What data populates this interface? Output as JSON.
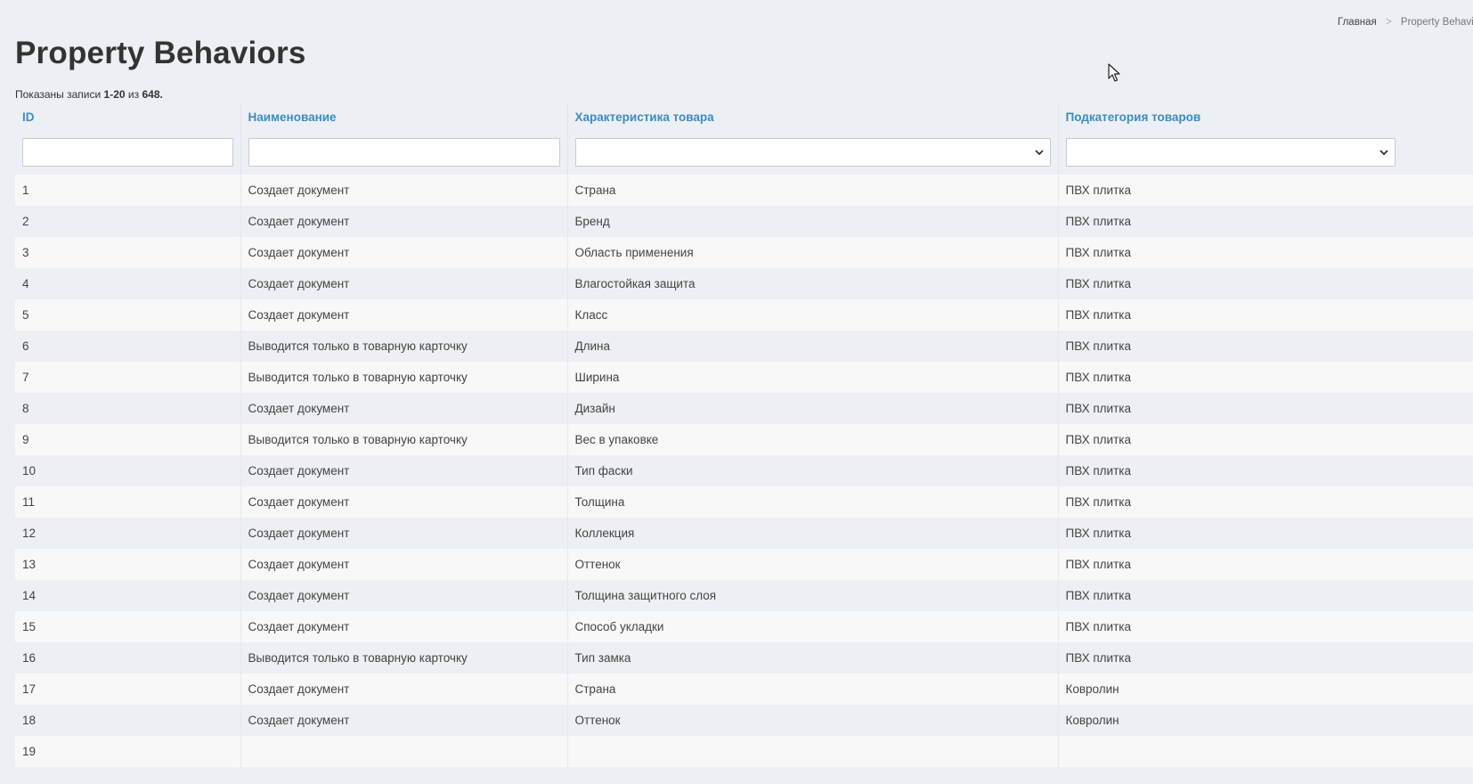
{
  "breadcrumb": {
    "home": "Главная",
    "separator": ">",
    "current": "Property Behaviors"
  },
  "page_title": "Property Behaviors",
  "summary": {
    "prefix": "Показаны записи",
    "range": "1-20",
    "of": "из",
    "total": "648."
  },
  "table": {
    "columns": [
      "ID",
      "Наименование",
      "Характеристика товара",
      "Подкатегория товаров"
    ],
    "filters": {
      "id": "",
      "name": "",
      "property_selected": "",
      "subcategory_selected": ""
    },
    "rows": [
      [
        "1",
        "Создает документ",
        "Страна",
        "ПВХ плитка"
      ],
      [
        "2",
        "Создает документ",
        "Бренд",
        "ПВХ плитка"
      ],
      [
        "3",
        "Создает документ",
        "Область применения",
        "ПВХ плитка"
      ],
      [
        "4",
        "Создает документ",
        "Влагостойкая защита",
        "ПВХ плитка"
      ],
      [
        "5",
        "Создает документ",
        "Класс",
        "ПВХ плитка"
      ],
      [
        "6",
        "Выводится только в товарную карточку",
        "Длина",
        "ПВХ плитка"
      ],
      [
        "7",
        "Выводится только в товарную карточку",
        "Ширина",
        "ПВХ плитка"
      ],
      [
        "8",
        "Создает документ",
        "Дизайн",
        "ПВХ плитка"
      ],
      [
        "9",
        "Выводится только в товарную карточку",
        "Вес в упаковке",
        "ПВХ плитка"
      ],
      [
        "10",
        "Создает документ",
        "Тип фаски",
        "ПВХ плитка"
      ],
      [
        "11",
        "Создает документ",
        "Толщина",
        "ПВХ плитка"
      ],
      [
        "12",
        "Создает документ",
        "Коллекция",
        "ПВХ плитка"
      ],
      [
        "13",
        "Создает документ",
        "Оттенок",
        "ПВХ плитка"
      ],
      [
        "14",
        "Создает документ",
        "Толщина защитного слоя",
        "ПВХ плитка"
      ],
      [
        "15",
        "Создает документ",
        "Способ укладки",
        "ПВХ плитка"
      ],
      [
        "16",
        "Выводится только в товарную карточку",
        "Тип замка",
        "ПВХ плитка"
      ],
      [
        "17",
        "Создает документ",
        "Страна",
        "Ковролин"
      ],
      [
        "18",
        "Создает документ",
        "Оттенок",
        "Ковролин"
      ],
      [
        "19",
        "",
        "",
        ""
      ]
    ]
  },
  "icons": {
    "select_arrow": "chevron-down-icon",
    "cursor": "mouse-pointer-icon"
  },
  "colors": {
    "background": "#eceff4",
    "link": "#3c8dbc",
    "row_odd": "#f8f8f9",
    "row_even": "#eceff3"
  }
}
